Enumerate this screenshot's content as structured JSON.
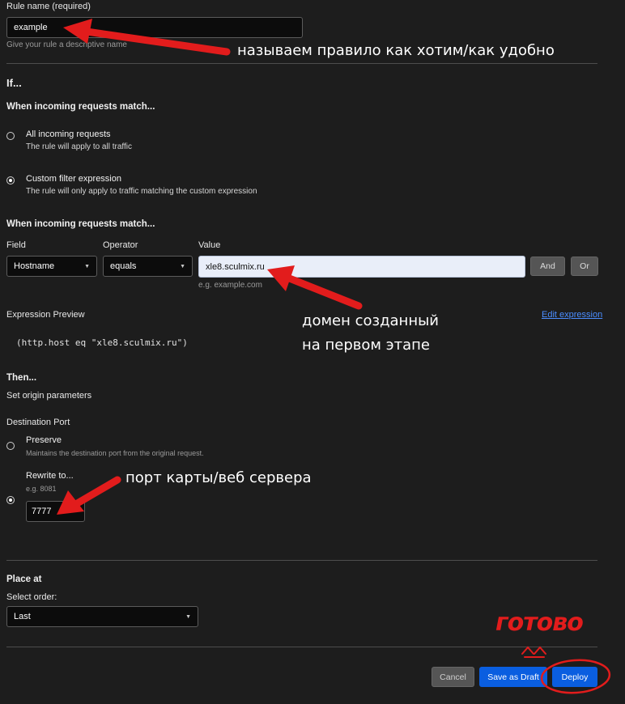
{
  "rule_name": {
    "label": "Rule name (required)",
    "value": "example",
    "help": "Give your rule a descriptive name"
  },
  "if_section": {
    "title": "If...",
    "match_heading": "When incoming requests match...",
    "options": [
      {
        "title": "All incoming requests",
        "desc": "The rule will apply to all traffic",
        "selected": false
      },
      {
        "title": "Custom filter expression",
        "desc": "The rule will only apply to traffic matching the custom expression",
        "selected": true
      }
    ]
  },
  "filter": {
    "heading": "When incoming requests match...",
    "field_label": "Field",
    "operator_label": "Operator",
    "value_label": "Value",
    "field_value": "Hostname",
    "operator_value": "equals",
    "value_value": "xle8.sculmix.ru",
    "value_hint": "e.g. example.com",
    "and_label": "And",
    "or_label": "Or"
  },
  "expression": {
    "label": "Expression Preview",
    "edit_link": "Edit expression",
    "code": "(http.host eq \"xle8.sculmix.ru\")"
  },
  "then_section": {
    "title": "Then...",
    "subtitle": "Set origin parameters",
    "port_label": "Destination Port",
    "preserve_title": "Preserve",
    "preserve_desc": "Maintains the destination port from the original request.",
    "rewrite_title": "Rewrite to...",
    "rewrite_hint": "e.g. 8081",
    "rewrite_value": "7777",
    "selected": "rewrite"
  },
  "place_at": {
    "title": "Place at",
    "select_label": "Select order:",
    "value": "Last"
  },
  "actions": {
    "cancel": "Cancel",
    "save_draft": "Save as Draft",
    "deploy": "Deploy"
  },
  "annotations": {
    "rule_name_note": "называем правило как хотим/как удобно",
    "domain_note_line1": "домен созданный",
    "domain_note_line2": "на первом этапе",
    "port_note": "порт карты/веб сервера",
    "handwritten": "готово"
  },
  "colors": {
    "background": "#1d1d1d",
    "accent_blue": "#0a5ee0",
    "annotation_red": "#e21c1c"
  }
}
